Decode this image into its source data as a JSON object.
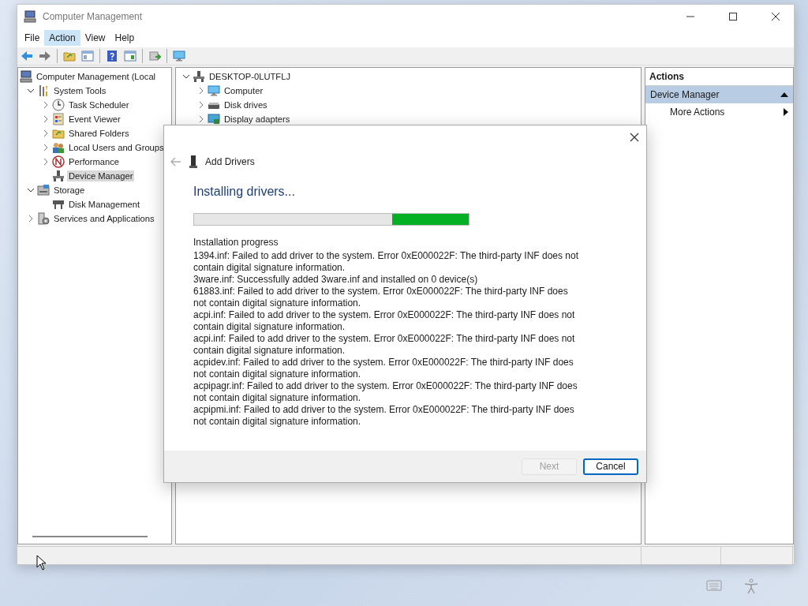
{
  "window": {
    "title": "Computer Management"
  },
  "menu": [
    {
      "label": "File",
      "selected": false
    },
    {
      "label": "Action",
      "selected": true
    },
    {
      "label": "View",
      "selected": false
    },
    {
      "label": "Help",
      "selected": false
    }
  ],
  "tree": [
    {
      "label": "Computer Management (Local",
      "kind": "computer",
      "selected": false,
      "children": [
        {
          "label": "System Tools",
          "kind": "tools",
          "expanded": true,
          "selected": false,
          "children": [
            {
              "label": "Task Scheduler",
              "kind": "clock",
              "expanded": false,
              "selected": false
            },
            {
              "label": "Event Viewer",
              "kind": "log",
              "expanded": false,
              "selected": false
            },
            {
              "label": "Shared Folders",
              "kind": "folder",
              "expanded": false,
              "selected": false
            },
            {
              "label": "Local Users and Groups",
              "kind": "users",
              "expanded": false,
              "selected": false
            },
            {
              "label": "Performance",
              "kind": "gauge",
              "expanded": false,
              "selected": false
            },
            {
              "label": "Device Manager",
              "kind": "device",
              "selected": true
            }
          ]
        },
        {
          "label": "Storage",
          "kind": "storage",
          "expanded": true,
          "selected": false,
          "children": [
            {
              "label": "Disk Management",
              "kind": "disk",
              "selected": false
            }
          ]
        },
        {
          "label": "Services and Applications",
          "kind": "services",
          "expanded": false,
          "selected": false
        }
      ]
    }
  ],
  "devices": [
    {
      "label": "DESKTOP-0LUTFLJ",
      "kind": "device",
      "expanded": true,
      "children": [
        {
          "label": "Computer",
          "kind": "monitor",
          "expanded": false
        },
        {
          "label": "Disk drives",
          "kind": "drive",
          "expanded": false
        },
        {
          "label": "Display adapters",
          "kind": "adapter",
          "expanded": false
        }
      ]
    }
  ],
  "actions": {
    "header": "Actions",
    "section": {
      "label": "Device Manager",
      "expanded": true
    },
    "items": [
      {
        "label": "More Actions"
      }
    ]
  },
  "dialog": {
    "title": "Add Drivers",
    "heading": "Installing drivers...",
    "progress": {
      "level": 0.28
    },
    "log_label": "Installation progress",
    "log": [
      "1394.inf: Failed to add driver to the system. Error 0xE000022F: The third-party INF does not contain digital signature information.",
      "3ware.inf: Successfully added 3ware.inf and installed on 0 device(s)",
      "61883.inf: Failed to add driver to the system. Error 0xE000022F: The third-party INF does not contain digital signature information.",
      "acpi.inf: Failed to add driver to the system. Error 0xE000022F: The third-party INF does not contain digital signature information.",
      "acpi.inf: Failed to add driver to the system. Error 0xE000022F: The third-party INF does not contain digital signature information.",
      "acpidev.inf: Failed to add driver to the system. Error 0xE000022F: The third-party INF does not contain digital signature information.",
      "acpipagr.inf: Failed to add driver to the system. Error 0xE000022F: The third-party INF does not contain digital signature information.",
      "acpipmi.inf: Failed to add driver to the system. Error 0xE000022F: The third-party INF does not contain digital signature information."
    ],
    "buttons": [
      {
        "label": "Next",
        "disabled": true
      },
      {
        "label": "Cancel",
        "disabled": false
      }
    ]
  }
}
